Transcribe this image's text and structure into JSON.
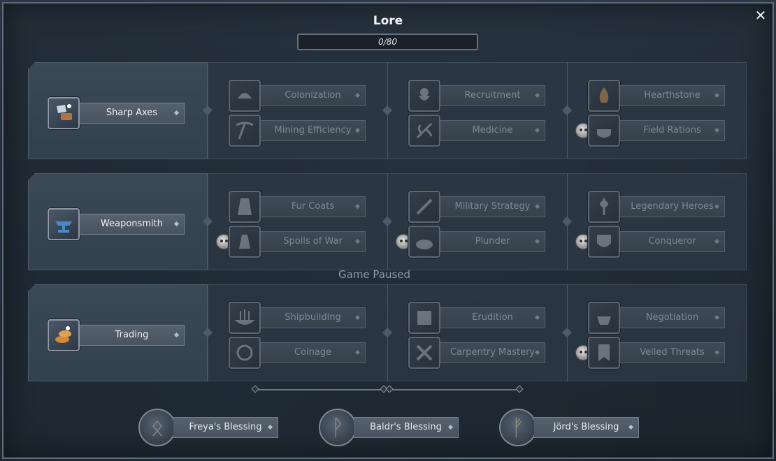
{
  "window": {
    "title": "Lore",
    "close_glyph": "✕"
  },
  "progress": {
    "text": "0/80",
    "fraction": 0
  },
  "status": {
    "paused": "Game Paused"
  },
  "rows": [
    {
      "lead": {
        "label": "Sharp Axes",
        "icon": "sharp-axes-icon"
      },
      "skills": [
        {
          "label": "Colonization",
          "icon": "colonization-icon",
          "skull": false
        },
        {
          "label": "Mining Efficiency",
          "icon": "pickaxe-icon",
          "skull": false
        },
        {
          "label": "Recruitment",
          "icon": "bearded-man-icon",
          "skull": false
        },
        {
          "label": "Medicine",
          "icon": "herb-icon",
          "skull": false
        },
        {
          "label": "Hearthstone",
          "icon": "fire-icon",
          "skull": false
        },
        {
          "label": "Field Rations",
          "icon": "cooking-pot-icon",
          "skull": true
        }
      ]
    },
    {
      "lead": {
        "label": "Weaponsmith",
        "icon": "anvil-icon"
      },
      "skills": [
        {
          "label": "Fur Coats",
          "icon": "fur-coat-icon",
          "skull": false
        },
        {
          "label": "Spoils of War",
          "icon": "loot-sack-icon",
          "skull": true
        },
        {
          "label": "Military Strategy",
          "icon": "sword-icon",
          "skull": false
        },
        {
          "label": "Plunder",
          "icon": "treasure-pile-icon",
          "skull": true
        },
        {
          "label": "Legendary Heroes",
          "icon": "axe-icon",
          "skull": false
        },
        {
          "label": "Conqueror",
          "icon": "armor-icon",
          "skull": true
        }
      ]
    },
    {
      "lead": {
        "label": "Trading",
        "icon": "coins-icon"
      },
      "skills": [
        {
          "label": "Shipbuilding",
          "icon": "longship-icon",
          "skull": false
        },
        {
          "label": "Coinage",
          "icon": "coin-icon",
          "skull": false
        },
        {
          "label": "Erudition",
          "icon": "map-icon",
          "skull": false
        },
        {
          "label": "Carpentry Mastery",
          "icon": "carpentry-icon",
          "skull": false
        },
        {
          "label": "Negotiation",
          "icon": "cauldron-icon",
          "skull": false
        },
        {
          "label": "Veiled Threats",
          "icon": "banner-icon",
          "skull": true
        }
      ]
    }
  ],
  "blessings": [
    {
      "label": "Freya's Blessing",
      "rune": "ᛟ"
    },
    {
      "label": "Baldr's Blessing",
      "rune": "ᚹ"
    },
    {
      "label": "Jörd's Blessing",
      "rune": "ᚠ"
    }
  ],
  "colors": {
    "accent": "#6a8ba6",
    "panel": "#3b4957",
    "locked_text": "#7d8893"
  }
}
